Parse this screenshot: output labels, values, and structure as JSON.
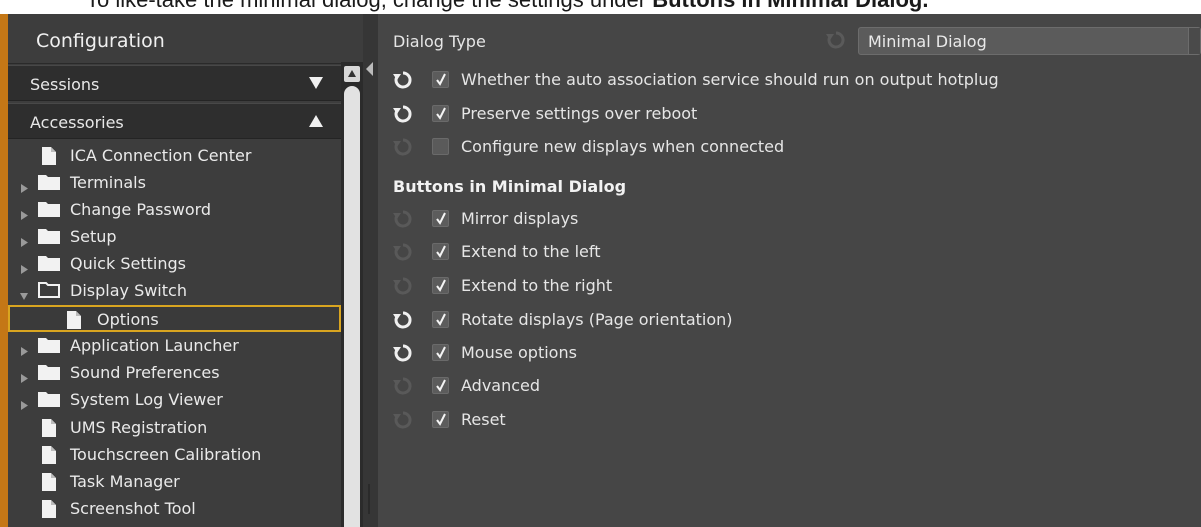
{
  "instruction": {
    "prefix": "To like-take the minimal dialog, change the settings under ",
    "bold": "Buttons in Minimal Dialog."
  },
  "sidebar": {
    "title": "Configuration",
    "sections": [
      {
        "label": "Sessions",
        "state": "collapsed"
      },
      {
        "label": "Accessories",
        "state": "expanded"
      }
    ],
    "items": [
      {
        "label": "ICA Connection Center",
        "icon": "file-icon"
      },
      {
        "label": "Terminals",
        "icon": "folder-icon"
      },
      {
        "label": "Change Password",
        "icon": "folder-icon"
      },
      {
        "label": "Setup",
        "icon": "folder-icon"
      },
      {
        "label": "Quick Settings",
        "icon": "folder-icon"
      },
      {
        "label": "Display Switch",
        "icon": "folder-open-icon"
      },
      {
        "label": "Options",
        "icon": "file-icon"
      },
      {
        "label": "Application Launcher",
        "icon": "folder-icon"
      },
      {
        "label": "Sound Preferences",
        "icon": "folder-icon"
      },
      {
        "label": "System Log Viewer",
        "icon": "folder-icon"
      },
      {
        "label": "UMS Registration",
        "icon": "file-icon"
      },
      {
        "label": "Touchscreen Calibration",
        "icon": "file-icon"
      },
      {
        "label": "Task Manager",
        "icon": "file-icon"
      },
      {
        "label": "Screenshot Tool",
        "icon": "file-icon"
      }
    ]
  },
  "main": {
    "dialog_type_label": "Dialog Type",
    "dialog_type_value": "Minimal Dialog",
    "settings": [
      {
        "label": "Whether the auto association service should run on output hotplug",
        "checked": true,
        "reset_active": true
      },
      {
        "label": "Preserve settings over reboot",
        "checked": true,
        "reset_active": true
      },
      {
        "label": "Configure new displays when connected",
        "checked": false,
        "reset_active": false
      }
    ],
    "buttons_heading": "Buttons in Minimal Dialog",
    "buttons": [
      {
        "label": "Mirror displays",
        "checked": true,
        "reset_active": false
      },
      {
        "label": "Extend to the left",
        "checked": true,
        "reset_active": false
      },
      {
        "label": "Extend to the right",
        "checked": true,
        "reset_active": false
      },
      {
        "label": "Rotate displays (Page orientation)",
        "checked": true,
        "reset_active": true
      },
      {
        "label": "Mouse options",
        "checked": true,
        "reset_active": true
      },
      {
        "label": "Advanced",
        "checked": true,
        "reset_active": false
      },
      {
        "label": "Reset",
        "checked": true,
        "reset_active": false
      }
    ]
  },
  "colors": {
    "accent_border": "#c47716",
    "selection_border": "#d9a520",
    "panel_bg": "#464646",
    "sidebar_bg": "#3d3d3d"
  }
}
